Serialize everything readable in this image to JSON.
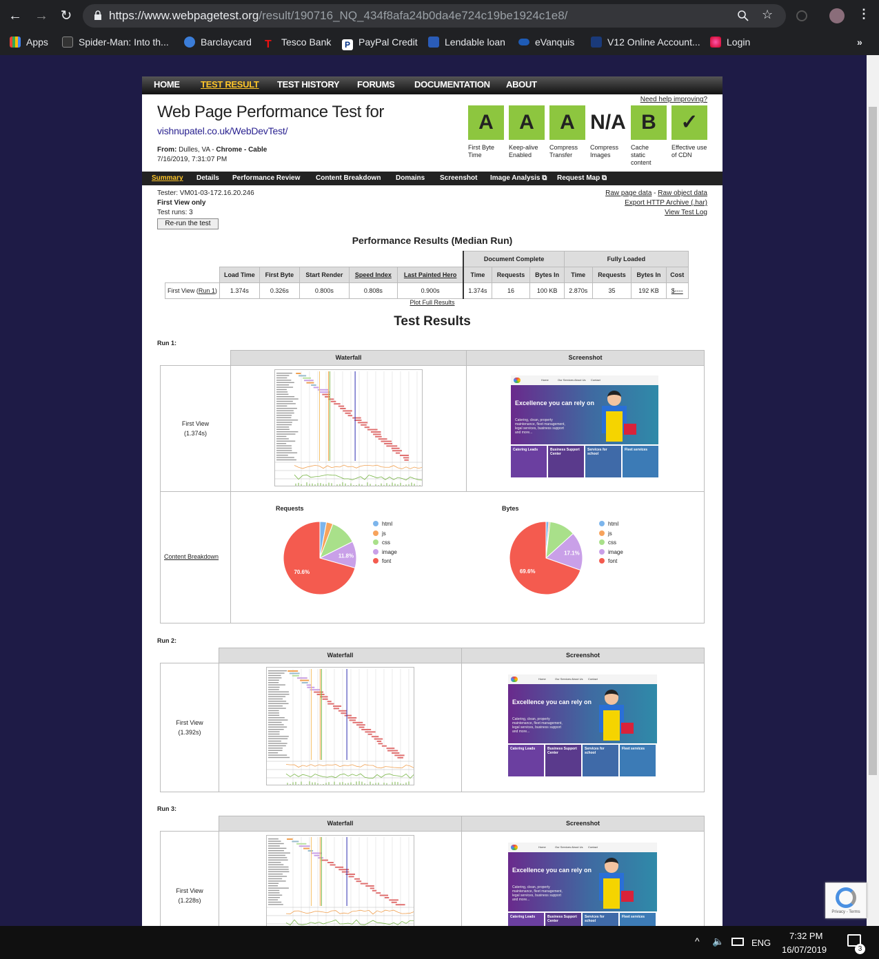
{
  "browser": {
    "url_host": "https://www.webpagetest.org",
    "url_path": "/result/190716_NQ_434f8afa24b0da4e724c19be1924c1e8/",
    "bookmarks": [
      "Apps",
      "Spider-Man: Into th...",
      "Barclaycard",
      "Tesco Bank",
      "PayPal Credit",
      "Lendable loan",
      "eVanquis",
      "V12 Online Account...",
      "Login"
    ]
  },
  "nav": {
    "items": [
      "HOME",
      "TEST RESULT",
      "TEST HISTORY",
      "FORUMS",
      "DOCUMENTATION",
      "ABOUT"
    ]
  },
  "header": {
    "title": "Web Page Performance Test for",
    "site": "vishnupatel.co.uk/WebDevTest/",
    "from_label": "From:",
    "from_value": "Dulles, VA - ",
    "browser": "Chrome - Cable",
    "date": "7/16/2019, 7:31:07 PM",
    "help": "Need help improving?"
  },
  "grades": [
    {
      "grade": "A",
      "label": "First Byte Time"
    },
    {
      "grade": "A",
      "label": "Keep-alive Enabled"
    },
    {
      "grade": "A",
      "label": "Compress Transfer"
    },
    {
      "grade": "N/A",
      "label": "Compress Images"
    },
    {
      "grade": "B",
      "label": "Cache static content"
    },
    {
      "grade": "✓",
      "label": "Effective use of CDN"
    }
  ],
  "subnav": {
    "items": [
      "Summary",
      "Details",
      "Performance Review",
      "Content Breakdown",
      "Domains",
      "Screenshot",
      "Image Analysis ⧉",
      "Request Map ⧉"
    ]
  },
  "info": {
    "tester": "Tester: VM01-03-172.16.20.246",
    "view": "First View only",
    "runs": "Test runs: 3",
    "rerun": "Re-run the test",
    "raw_page": "Raw page data",
    "sep": " - ",
    "raw_object": "Raw object data",
    "har": "Export HTTP Archive (.har)",
    "log": "View Test Log"
  },
  "perf": {
    "title": "Performance Results (Median Run)",
    "group_doc": "Document Complete",
    "group_full": "Fully Loaded",
    "headers": [
      "Load Time",
      "First Byte",
      "Start Render",
      "Speed Index",
      "Last Painted Hero",
      "Time",
      "Requests",
      "Bytes In",
      "Time",
      "Requests",
      "Bytes In",
      "Cost"
    ],
    "row_label": "First View (",
    "row_run": "Run 1",
    "row_end": ")",
    "values": [
      "1.374s",
      "0.326s",
      "0.800s",
      "0.808s",
      "0.900s",
      "1.374s",
      "16",
      "100 KB",
      "2.870s",
      "35",
      "192 KB",
      "$----"
    ],
    "plot": "Plot Full Results"
  },
  "results": {
    "title": "Test Results",
    "waterfall": "Waterfall",
    "screenshot": "Screenshot",
    "content": "Content Breakdown",
    "runs": [
      {
        "label": "Run 1:",
        "view": "First View",
        "time": "(1.374s)"
      },
      {
        "label": "Run 2:",
        "view": "First View",
        "time": "(1.392s)"
      },
      {
        "label": "Run 3:",
        "view": "First View",
        "time": "(1.228s)"
      }
    ]
  },
  "shot": {
    "title": "Excellence you can rely on",
    "sub": "Catering, clean, property maintenance, fleet management, legal services, business support and more...",
    "tiles": [
      "Catering Leads",
      "Business Support Center",
      "Services for school",
      "Fleet services"
    ],
    "menu": [
      "Home",
      "Our Services",
      "About Us",
      "Contact"
    ]
  },
  "chart_data": [
    {
      "type": "pie",
      "title": "Requests",
      "categories": [
        "html",
        "js",
        "css",
        "image",
        "font"
      ],
      "values": [
        2.9,
        2.9,
        11.8,
        11.8,
        70.6
      ],
      "labels": [
        "",
        "",
        "",
        "11.8%",
        "70.6%"
      ],
      "colors": [
        "#7cb5ec",
        "#f7a35c",
        "#a9e08a",
        "#c9a0e8",
        "#f45b4f"
      ]
    },
    {
      "type": "pie",
      "title": "Bytes",
      "categories": [
        "html",
        "js",
        "css",
        "image",
        "font"
      ],
      "values": [
        1.2,
        0.6,
        11.5,
        17.1,
        69.6
      ],
      "labels": [
        "",
        "",
        "",
        "17.1%",
        "69.6%"
      ],
      "colors": [
        "#7cb5ec",
        "#f7a35c",
        "#a9e08a",
        "#c9a0e8",
        "#f45b4f"
      ]
    }
  ],
  "taskbar": {
    "lang": "ENG",
    "time": "7:32 PM",
    "date": "16/07/2019",
    "notif": "3"
  },
  "recaptcha": {
    "text": "Privacy - Terms"
  }
}
